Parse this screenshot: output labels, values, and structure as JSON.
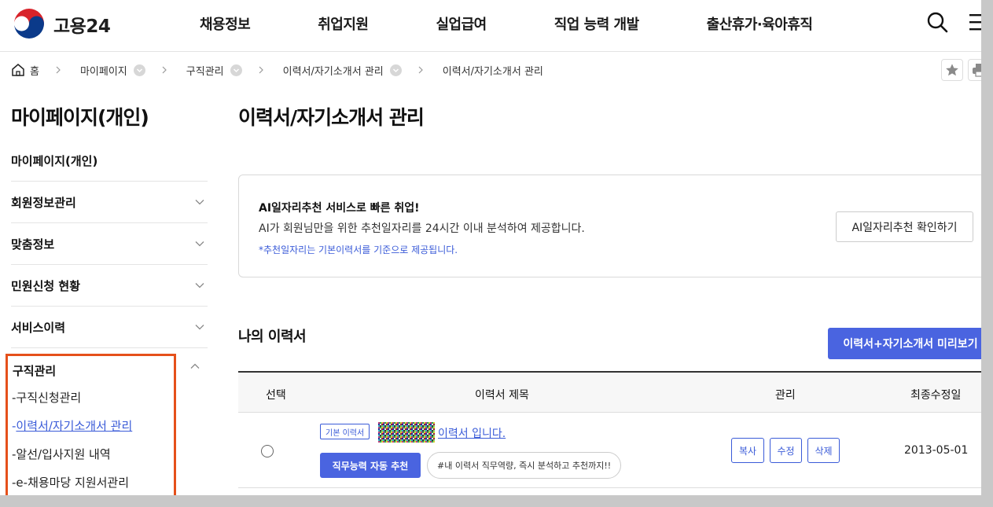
{
  "header": {
    "logo_text": "고용24",
    "nav": [
      "채용정보",
      "취업지원",
      "실업급여",
      "직업 능력 개발",
      "출산휴가·육아휴직"
    ]
  },
  "breadcrumb": {
    "items": [
      "홈",
      "마이페이지",
      "구직관리",
      "이력서/자기소개서 관리",
      "이력서/자기소개서 관리"
    ]
  },
  "sidebar": {
    "title": "마이페이지(개인)",
    "items": [
      "마이페이지(개인)",
      "회원정보관리",
      "맞춤정보",
      "민원신청 현황",
      "서비스이력"
    ],
    "active_group": {
      "label": "구직관리",
      "children": [
        "구직신청관리",
        "이력서/자기소개서 관리",
        "알선/입사지원 내역",
        "e-채용마당 지원서관리"
      ]
    }
  },
  "main": {
    "title": "이력서/자기소개서 관리",
    "ai_box": {
      "heading": "AI일자리추천 서비스로 빠른 취업!",
      "description": "AI가 회원님만을 위한 추천일자리를 24시간 이내 분석하여 제공합니다.",
      "note": "*추천일자리는 기본이력서를 기준으로 제공됩니다.",
      "button": "AI일자리추천 확인하기"
    },
    "resume_section": {
      "title": "나의 이력서",
      "preview_button": "이력서+자기소개서 미리보기"
    },
    "table": {
      "headers": [
        "선택",
        "이력서 제목",
        "관리",
        "최종수정일"
      ],
      "rows": [
        {
          "badge": "기본 이력서",
          "title_suffix": "이력서 입니다.",
          "skill_button": "직무능력 자동 추천",
          "skill_tag": "#내 이력서 직무역량, 즉시 분석하고 추천까지!!",
          "actions": [
            "복사",
            "수정",
            "삭제"
          ],
          "date": "2013-05-01"
        }
      ]
    }
  },
  "colors": {
    "accent": "#4a64e0",
    "link": "#3a5bd8",
    "highlight_border": "#e5501b"
  }
}
